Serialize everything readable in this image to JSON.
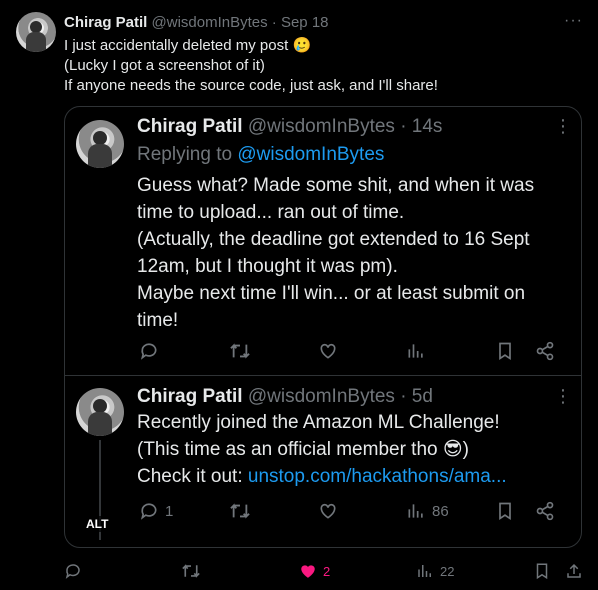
{
  "outer": {
    "name": "Chirag Patil",
    "handle": "@wisdomInBytes · Sep 18",
    "lines": [
      "I just accidentally deleted my post 🥲",
      "(Lucky I got a screenshot of it)",
      "If anyone needs the source code, just ask, and I'll share!"
    ],
    "actions": {
      "like_count": "2",
      "views_count": "22"
    }
  },
  "reply_tweet": {
    "name": "Chirag Patil",
    "handle": "@wisdomInBytes · 14s",
    "replying_prefix": "Replying to",
    "replying_handle": "@wisdomInBytes",
    "lines": [
      "Guess what? Made some shit, and when it was",
      "time to upload... ran out of time.",
      "(Actually, the deadline got extended to 16 Sept",
      "12am, but I thought it was pm).",
      "Maybe next time I'll win... or at least submit on",
      "time!"
    ]
  },
  "orig_tweet": {
    "name": "Chirag Patil",
    "handle": "@wisdomInBytes · 5d",
    "lines": [
      "Recently joined the Amazon ML Challenge!",
      "(This time as an official member tho 😎)"
    ],
    "checkout_prefix": "Check it out:",
    "link": "unstop.com/hackathons/ama...",
    "reply_count": "1",
    "views_count": "86",
    "alt_badge": "ALT"
  },
  "colors": {
    "accent": "#1d9bf0",
    "like": "#f91880",
    "muted": "#71767b",
    "text": "#e7e9ea",
    "border": "#2f3336"
  },
  "icons": [
    "more-icon",
    "reply-icon",
    "retweet-icon",
    "like-icon",
    "views-icon",
    "bookmark-icon",
    "share-icon",
    "upload-icon"
  ]
}
